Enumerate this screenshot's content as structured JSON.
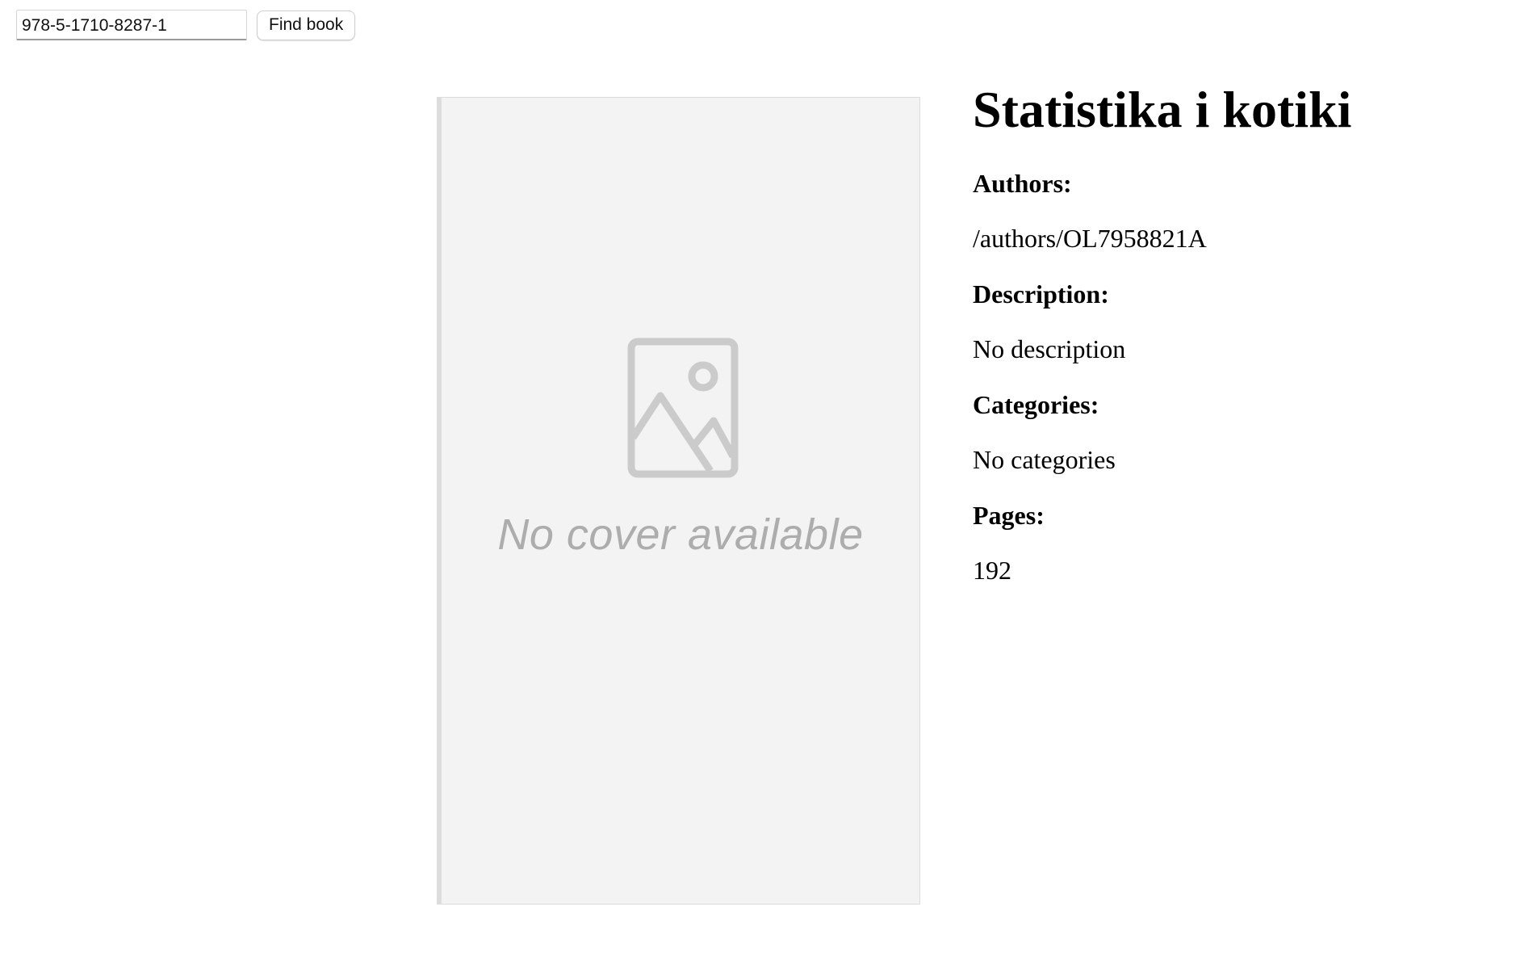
{
  "search": {
    "isbn_value": "978-5-1710-8287-1",
    "button_label": "Find book"
  },
  "cover": {
    "placeholder_text": "No cover available",
    "icon": "image-placeholder-icon"
  },
  "book": {
    "title": "Statistika i kotiki",
    "authors_label": "Authors:",
    "authors_value": "/authors/OL7958821A",
    "description_label": "Description:",
    "description_value": "No description",
    "categories_label": "Categories:",
    "categories_value": "No categories",
    "pages_label": "Pages:",
    "pages_value": "192"
  }
}
